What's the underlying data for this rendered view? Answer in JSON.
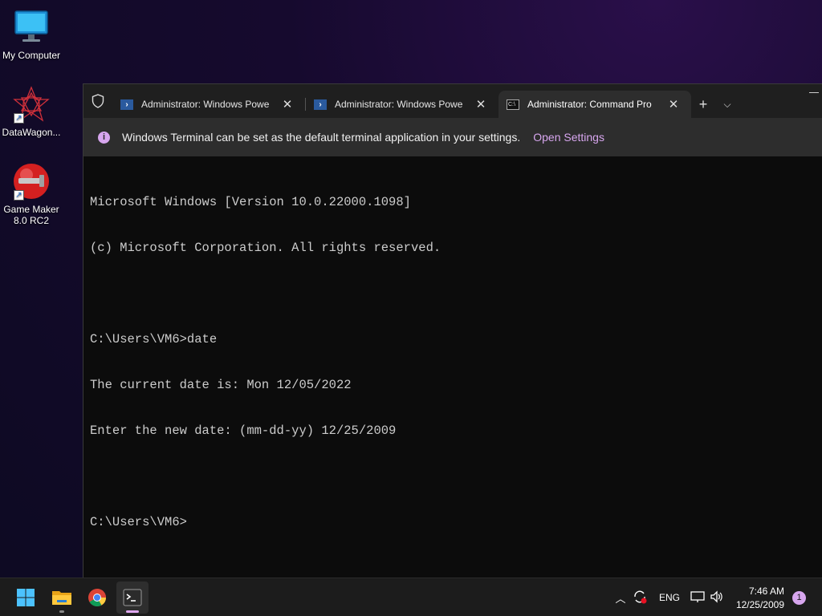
{
  "desktop": {
    "icons": [
      {
        "label": "My Computer",
        "icon": "monitor-icon"
      },
      {
        "label": "DataWagon...",
        "icon": "datawagon-app-icon"
      },
      {
        "label": "Game Maker\n8.0 RC2",
        "icon": "game-maker-icon"
      }
    ]
  },
  "terminal": {
    "tabs": [
      {
        "title": "Administrator: Windows Powe",
        "icon": "powershell-icon",
        "active": false
      },
      {
        "title": "Administrator: Windows Powe",
        "icon": "powershell-icon",
        "active": false
      },
      {
        "title": "Administrator: Command Pro",
        "icon": "cmd-icon",
        "active": true
      }
    ],
    "new_tab_label": "+",
    "dropdown_label": "⌵",
    "infobar": {
      "icon": "i",
      "message": "Windows Terminal can be set as the default terminal application in your settings.",
      "link": "Open Settings"
    },
    "console_lines": [
      "Microsoft Windows [Version 10.0.22000.1098]",
      "(c) Microsoft Corporation. All rights reserved.",
      "",
      "C:\\Users\\VM6>date",
      "The current date is: Mon 12/05/2022",
      "Enter the new date: (mm-dd-yy) 12/25/2009",
      "",
      "C:\\Users\\VM6>"
    ]
  },
  "taskbar": {
    "apps": [
      "start-icon",
      "file-explorer-icon",
      "chrome-icon",
      "terminal-icon"
    ],
    "tray": {
      "language": "ENG",
      "time": "7:46 AM",
      "date": "12/25/2009",
      "notifications": "1"
    }
  },
  "colors": {
    "accent": "#d7a6ee",
    "console_bg": "#0c0c0c",
    "console_text": "#cccccc"
  }
}
